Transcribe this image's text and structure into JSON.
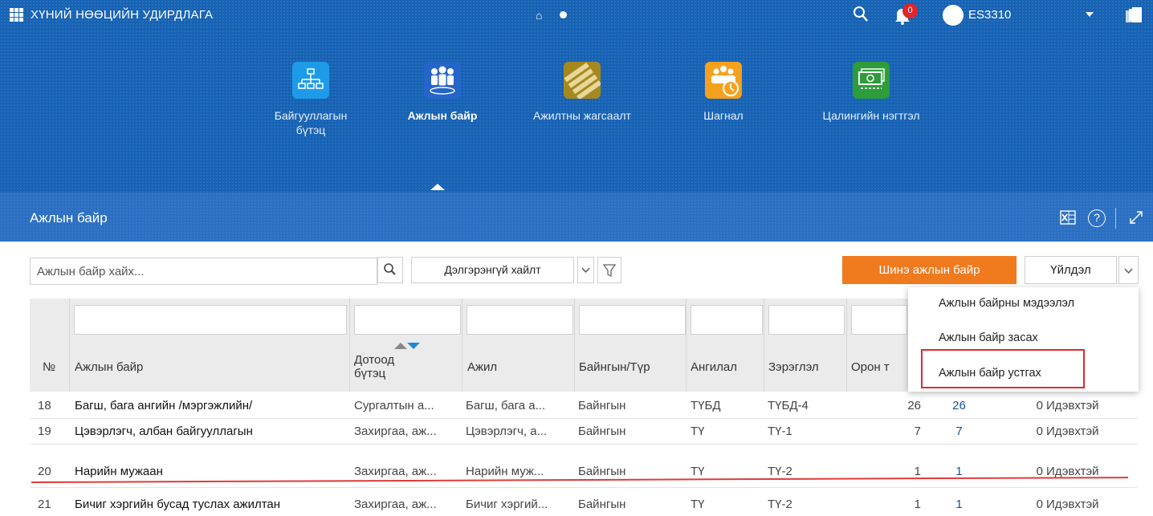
{
  "topbar": {
    "app_title": "ХҮНИЙ НӨӨЦИЙН УДИРДЛАГА",
    "notifications_count": "0",
    "user_name": "ES3310",
    "icons": [
      "app-grid-icon",
      "home-icon",
      "dot-icon",
      "search-icon",
      "bell-icon",
      "avatar",
      "chevron-down-icon",
      "documents-icon"
    ]
  },
  "modules": [
    {
      "label": "Байгууллагын бүтэц",
      "icon": "org-structure-icon",
      "color": "#1e9be8",
      "active": false
    },
    {
      "label": "Ажлын байр",
      "icon": "workplace-people-icon",
      "color": "#2565c9",
      "active": true
    },
    {
      "label": "Ажилтны жагсаалт",
      "icon": "employee-list-icon",
      "color": "#a6891e",
      "active": false
    },
    {
      "label": "Шагнал",
      "icon": "award-icon",
      "color": "#f6a11e",
      "active": false
    },
    {
      "label": "Цалингийн нэгтгэл",
      "icon": "salary-icon",
      "color": "#2d9c3a",
      "active": false
    }
  ],
  "panel": {
    "title": "Ажлын байр",
    "icons": [
      "excel-icon",
      "help-icon",
      "expand-icon"
    ],
    "help_glyph": "?"
  },
  "toolbar": {
    "search_placeholder": "Ажлын байр хайх...",
    "advanced_search_label": "Дэлгэрэнгүй хайлт",
    "new_button_label": "Шинэ ажлын байр",
    "actions_label": "Үйлдэл"
  },
  "actions_menu": {
    "items": [
      "Ажлын байрны мэдээлэл",
      "Ажлын байр засах",
      "Ажлын байр устгах"
    ],
    "highlighted_index": 2
  },
  "table": {
    "columns": [
      "№",
      "Ажлын байр",
      "Дотоод бүтэц",
      "Ажил",
      "Байнгын/Түр",
      "Ангилал",
      "Зэрэглэл",
      "Орон т"
    ],
    "sorted_column": "Дотоод бүтэц",
    "rows": [
      {
        "no": "18",
        "name": "Багш, бага ангийн /мэргэжлийн/",
        "unit": "Сургалтын а...",
        "job": "Багш, бага а...",
        "type": "Байнгын",
        "category": "ТҮБД",
        "grade": "ТҮБД-4",
        "seats": "26",
        "filled": "26",
        "vacant": "0",
        "status": "Идэвхтэй"
      },
      {
        "no": "19",
        "name": "Цэвэрлэгч, албан байгууллагын",
        "unit": "Захиргаа, аж...",
        "job": "Цэвэрлэгч, а...",
        "type": "Байнгын",
        "category": "ТҮ",
        "grade": "ТҮ-1",
        "seats": "7",
        "filled": "7",
        "vacant": "0",
        "status": "Идэвхтэй"
      },
      {
        "no": "20",
        "name": "Нарийн мужаан",
        "unit": "Захиргаа, аж...",
        "job": "Нарийн муж...",
        "type": "Байнгын",
        "category": "ТҮ",
        "grade": "ТҮ-2",
        "seats": "1",
        "filled": "1",
        "vacant": "0",
        "status": "Идэвхтэй"
      },
      {
        "no": "21",
        "name": "Бичиг хэргийн бусад туслах ажилтан",
        "unit": "Захиргаа, аж...",
        "job": "Бичиг хэргий...",
        "type": "Байнгын",
        "category": "ТҮ",
        "grade": "ТҮ-2",
        "seats": "1",
        "filled": "1",
        "vacant": "0",
        "status": "Идэвхтэй"
      }
    ]
  },
  "colors": {
    "topbar": "#1662b4",
    "panel_header": "#2b6fc2",
    "accent_orange": "#f07a1e",
    "highlight_red": "#e02a2a"
  }
}
